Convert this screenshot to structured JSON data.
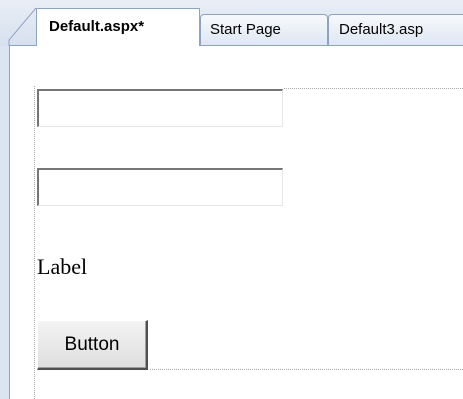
{
  "tabs": [
    {
      "label": "Default.aspx*",
      "active": true
    },
    {
      "label": "Start Page",
      "active": false
    },
    {
      "label": "Default3.asp",
      "active": false
    }
  ],
  "form": {
    "textbox1": {
      "value": ""
    },
    "textbox2": {
      "value": ""
    },
    "label_text": "Label",
    "button_label": "Button"
  }
}
